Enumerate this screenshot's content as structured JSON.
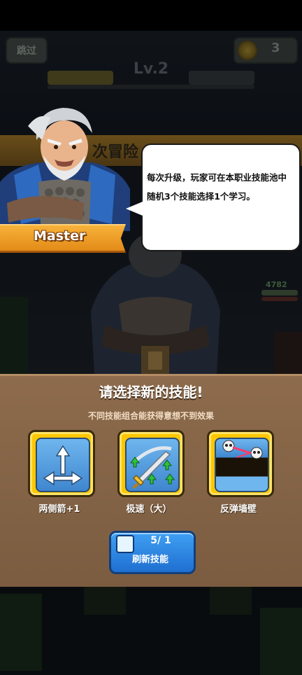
{
  "header": {
    "skip_label": "跳过",
    "coin_count": "3",
    "level_label": "Lv.2"
  },
  "banner": {
    "adventure_text": "次冒险"
  },
  "dialog": {
    "speaker_name": "Master",
    "message": "每次升级，玩家可在本职业技能池中随机3个技能选择1个学习。"
  },
  "enemy": {
    "hp_value": "4782"
  },
  "skill_panel": {
    "title": "请选择新的技能!",
    "subtitle": "不同技能组合能获得意想不到效果",
    "skills": [
      {
        "label": "两侧箭+1",
        "icon": "side-arrows-icon"
      },
      {
        "label": "极速（大）",
        "icon": "speed-sword-icon"
      },
      {
        "label": "反弹墙壁",
        "icon": "bounce-wall-icon"
      }
    ],
    "refresh": {
      "count": "5/ 1",
      "label": "刷新技能"
    }
  },
  "colors": {
    "card_gold": "#ffc700",
    "card_blue": "#4f9be0",
    "ribbon_orange": "#f0a02a",
    "panel_brown": "#86654a",
    "button_blue": "#2f88e0"
  }
}
